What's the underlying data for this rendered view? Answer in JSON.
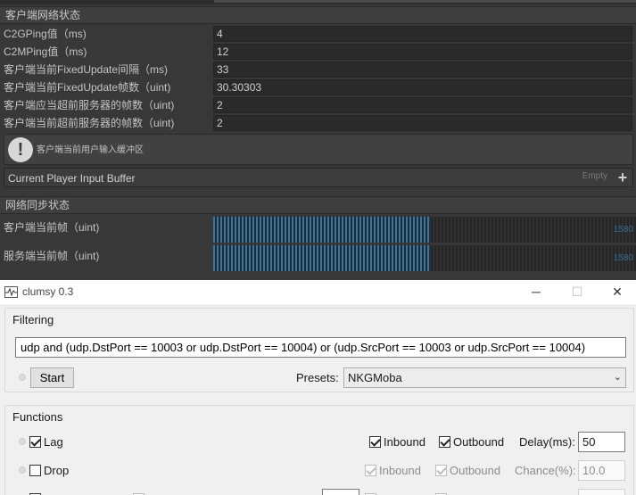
{
  "inspector": {
    "network_header": "客户端网络状态",
    "rows": [
      {
        "label": "C2GPing值（ms)",
        "value": "4"
      },
      {
        "label": "C2MPing值（ms)",
        "value": "12"
      },
      {
        "label": "客户端当前FixedUpdate间隔（ms)",
        "value": "33"
      },
      {
        "label": "客户端当前FixedUpdate帧数（uint)",
        "value": "30.30303"
      },
      {
        "label": "客户端应当超前服务器的帧数（uint)",
        "value": "2"
      },
      {
        "label": "客户端当前超前服务器的帧数（uint)",
        "value": "2"
      }
    ],
    "helpbox_text": "客户端当前用户输入缓冲区",
    "input_buffer_label": "Current Player Input Buffer",
    "input_buffer_empty": "Empty",
    "input_buffer_add": "+",
    "sync_header": "网络同步状态",
    "client_frame_label": "客户端当前帧（uint)",
    "client_frame_value": "1580",
    "client_frame_fill": 0.51,
    "server_frame_label": "服务端当前帧（uint)",
    "server_frame_value": "1580",
    "server_frame_fill": 0.51,
    "bar_color": "#3278a8"
  },
  "clumsy": {
    "title": "clumsy 0.3",
    "window_buttons": {
      "minimize": "─",
      "maximize": "☐",
      "close": "✕"
    },
    "filtering_label": "Filtering",
    "filter_text": "udp and (udp.DstPort == 10003 or udp.DstPort == 10004) or (udp.SrcPort == 10003 or udp.SrcPort == 10004)",
    "start_label": "Start",
    "presets_label": "Presets:",
    "preset_value": "NKGMoba",
    "functions_label": "Functions",
    "lag": {
      "label": "Lag",
      "checked": true,
      "inbound": "Inbound",
      "outbound": "Outbound",
      "param_label": "Delay(ms):",
      "param_value": "50"
    },
    "drop": {
      "label": "Drop",
      "checked": false,
      "inbound": "Inbound",
      "outbound": "Outbound",
      "param_label": "Chance(%):",
      "param_value": "10.0"
    }
  }
}
